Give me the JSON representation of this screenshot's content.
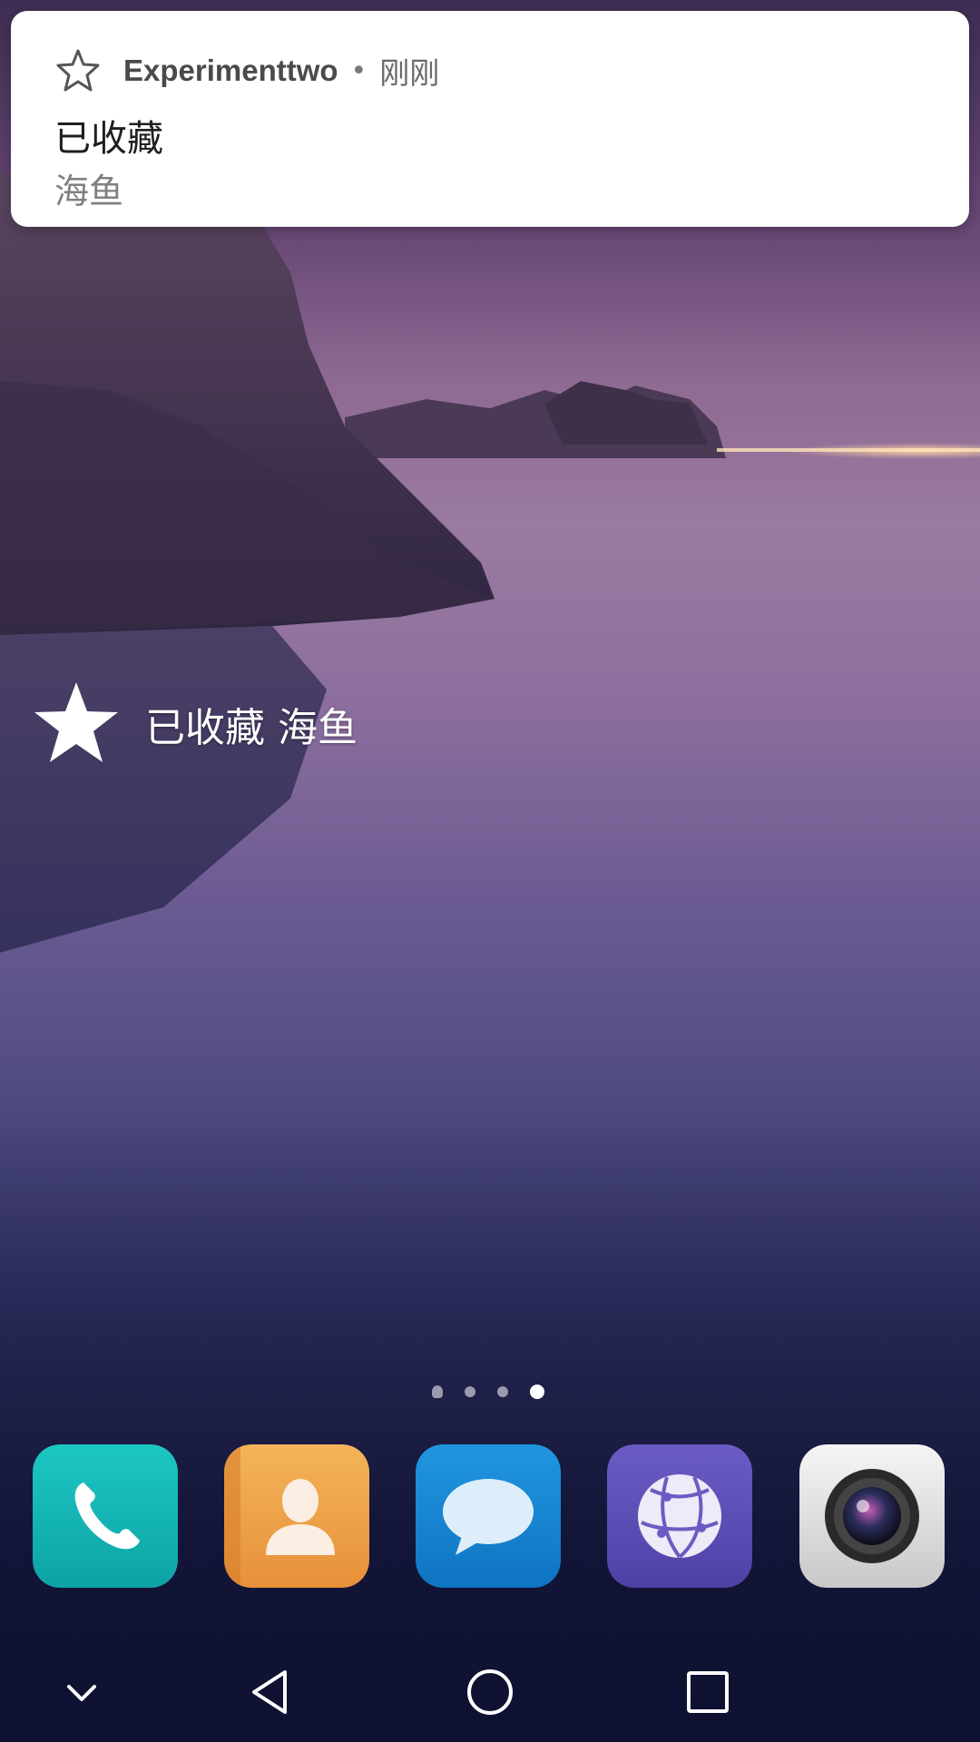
{
  "notification": {
    "app_name": "Experimenttwo",
    "separator": "•",
    "time": "刚刚",
    "title": "已收藏",
    "body": "海鱼",
    "icon": "star-outline-icon"
  },
  "toast": {
    "text": "已收藏 海鱼",
    "icon": "star-filled-icon"
  },
  "home": {
    "page_count": 4,
    "active_page": 4
  },
  "dock": {
    "apps": [
      {
        "name": "phone",
        "icon": "phone-icon",
        "color": "#14b9b8"
      },
      {
        "name": "contacts",
        "icon": "contacts-icon",
        "color": "#f0a64a"
      },
      {
        "name": "messages",
        "icon": "messages-icon",
        "color": "#1a86d4"
      },
      {
        "name": "browser",
        "icon": "browser-icon",
        "color": "#5b4fb6"
      },
      {
        "name": "camera",
        "icon": "camera-icon",
        "color": "#dcdcdc"
      }
    ]
  },
  "navbar": {
    "buttons": [
      "collapse-icon",
      "back-icon",
      "home-icon",
      "recents-icon"
    ]
  }
}
